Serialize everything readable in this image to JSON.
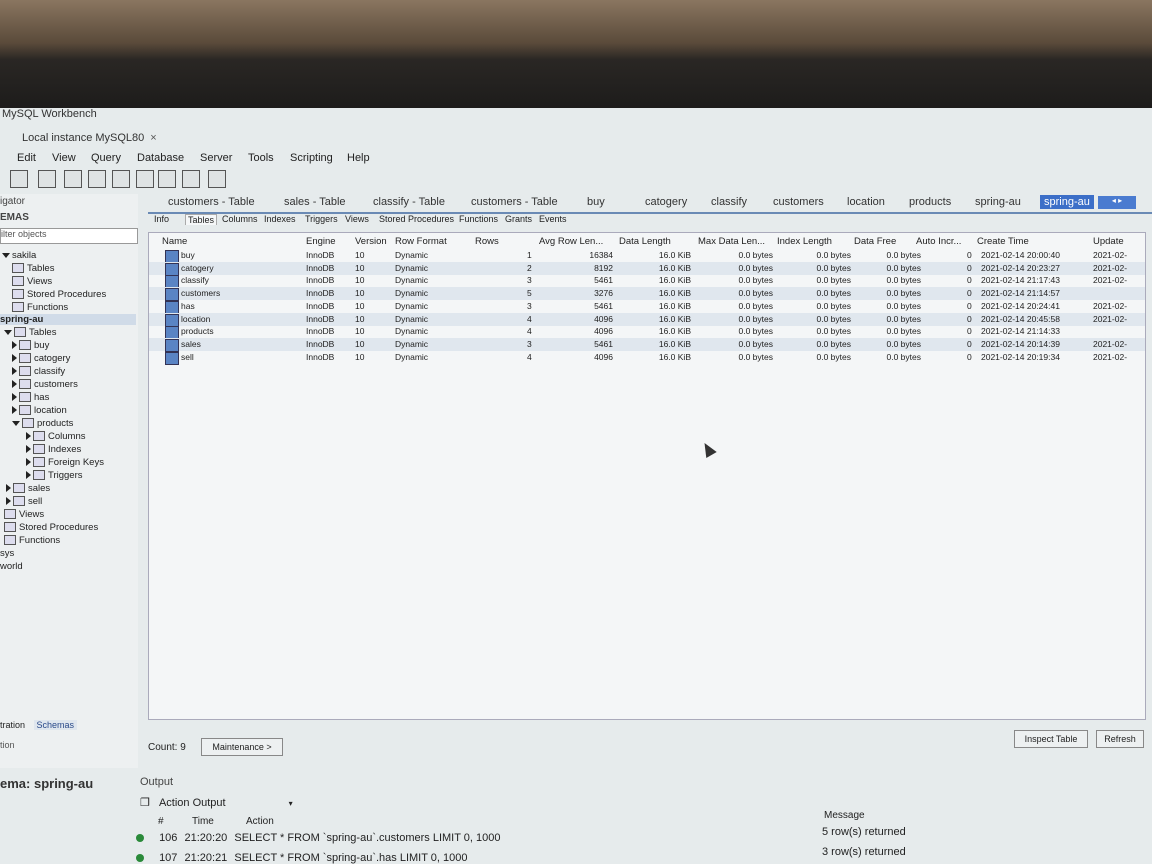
{
  "app": {
    "title": "MySQL Workbench",
    "connection_tab": "Local instance MySQL80",
    "close_glyph": "×"
  },
  "menu": [
    "Edit",
    "View",
    "Query",
    "Database",
    "Server",
    "Tools",
    "Scripting",
    "Help"
  ],
  "navigator": {
    "header": "igator",
    "schemas_label": "EMAS",
    "filter_placeholder": "ilter objects",
    "tree": [
      {
        "label": "sakila"
      },
      {
        "label": "Tables"
      },
      {
        "label": "Views"
      },
      {
        "label": "Stored Procedures"
      },
      {
        "label": "Functions"
      },
      {
        "label": "spring-au"
      },
      {
        "label": "Tables"
      },
      {
        "label": "buy"
      },
      {
        "label": "catogery"
      },
      {
        "label": "classify"
      },
      {
        "label": "customers"
      },
      {
        "label": "has"
      },
      {
        "label": "location"
      },
      {
        "label": "products"
      },
      {
        "label": "Columns"
      },
      {
        "label": "Indexes"
      },
      {
        "label": "Foreign Keys"
      },
      {
        "label": "Triggers"
      },
      {
        "label": "sales"
      },
      {
        "label": "sell"
      },
      {
        "label": "Views"
      },
      {
        "label": "Stored Procedures"
      },
      {
        "label": "Functions"
      },
      {
        "label": "sys"
      },
      {
        "label": "world"
      }
    ],
    "bottom_tabs": [
      "tration",
      "Schemas"
    ],
    "info_label": "tion",
    "schema_info": "ema: spring-au"
  },
  "doc_tabs": [
    "customers - Table",
    "sales - Table",
    "classify - Table",
    "customers - Table",
    "buy",
    "catogery",
    "classify",
    "customers",
    "location",
    "products",
    "spring-au",
    "spring-au"
  ],
  "nav_arrows": "◂ ▸",
  "sub_tabs": [
    "Info",
    "Tables",
    "Columns",
    "Indexes",
    "Triggers",
    "Views",
    "Stored Procedures",
    "Functions",
    "Grants",
    "Events"
  ],
  "table": {
    "columns": [
      "Name",
      "Engine",
      "Version",
      "Row Format",
      "Rows",
      "Avg Row Len...",
      "Data Length",
      "Max Data Len...",
      "Index Length",
      "Data Free",
      "Auto Incr...",
      "Create Time",
      "Update"
    ],
    "rows": [
      [
        "buy",
        "InnoDB",
        "10",
        "Dynamic",
        "1",
        "16384",
        "16.0 KiB",
        "0.0 bytes",
        "0.0 bytes",
        "0.0 bytes",
        "0",
        "2021-02-14 20:00:40",
        "2021-02-"
      ],
      [
        "catogery",
        "InnoDB",
        "10",
        "Dynamic",
        "2",
        "8192",
        "16.0 KiB",
        "0.0 bytes",
        "0.0 bytes",
        "0.0 bytes",
        "0",
        "2021-02-14 20:23:27",
        "2021-02-"
      ],
      [
        "classify",
        "InnoDB",
        "10",
        "Dynamic",
        "3",
        "5461",
        "16.0 KiB",
        "0.0 bytes",
        "0.0 bytes",
        "0.0 bytes",
        "0",
        "2021-02-14 21:17:43",
        "2021-02-"
      ],
      [
        "customers",
        "InnoDB",
        "10",
        "Dynamic",
        "5",
        "3276",
        "16.0 KiB",
        "0.0 bytes",
        "0.0 bytes",
        "0.0 bytes",
        "0",
        "2021-02-14 21:14:57",
        ""
      ],
      [
        "has",
        "InnoDB",
        "10",
        "Dynamic",
        "3",
        "5461",
        "16.0 KiB",
        "0.0 bytes",
        "0.0 bytes",
        "0.0 bytes",
        "0",
        "2021-02-14 20:24:41",
        "2021-02-"
      ],
      [
        "location",
        "InnoDB",
        "10",
        "Dynamic",
        "4",
        "4096",
        "16.0 KiB",
        "0.0 bytes",
        "0.0 bytes",
        "0.0 bytes",
        "0",
        "2021-02-14 20:45:58",
        "2021-02-"
      ],
      [
        "products",
        "InnoDB",
        "10",
        "Dynamic",
        "4",
        "4096",
        "16.0 KiB",
        "0.0 bytes",
        "0.0 bytes",
        "0.0 bytes",
        "0",
        "2021-02-14 21:14:33",
        ""
      ],
      [
        "sales",
        "InnoDB",
        "10",
        "Dynamic",
        "3",
        "5461",
        "16.0 KiB",
        "0.0 bytes",
        "0.0 bytes",
        "0.0 bytes",
        "0",
        "2021-02-14 20:14:39",
        "2021-02-"
      ],
      [
        "sell",
        "InnoDB",
        "10",
        "Dynamic",
        "4",
        "4096",
        "16.0 KiB",
        "0.0 bytes",
        "0.0 bytes",
        "0.0 bytes",
        "0",
        "2021-02-14 20:19:34",
        "2021-02-"
      ]
    ]
  },
  "footer": {
    "count": "Count: 9",
    "maintenance": "Maintenance >",
    "inspect": "Inspect Table",
    "refresh": "Refresh"
  },
  "output": {
    "header": "Output",
    "selector": "Action Output",
    "columns": [
      "#",
      "Time",
      "Action",
      "Message"
    ],
    "rows": [
      {
        "num": "106",
        "time": "21:20:20",
        "action": "SELECT * FROM `spring-au`.customers LIMIT 0, 1000",
        "message": "5 row(s) returned"
      },
      {
        "num": "107",
        "time": "21:20:21",
        "action": "SELECT * FROM `spring-au`.has LIMIT 0, 1000",
        "message": "3 row(s) returned"
      }
    ]
  }
}
